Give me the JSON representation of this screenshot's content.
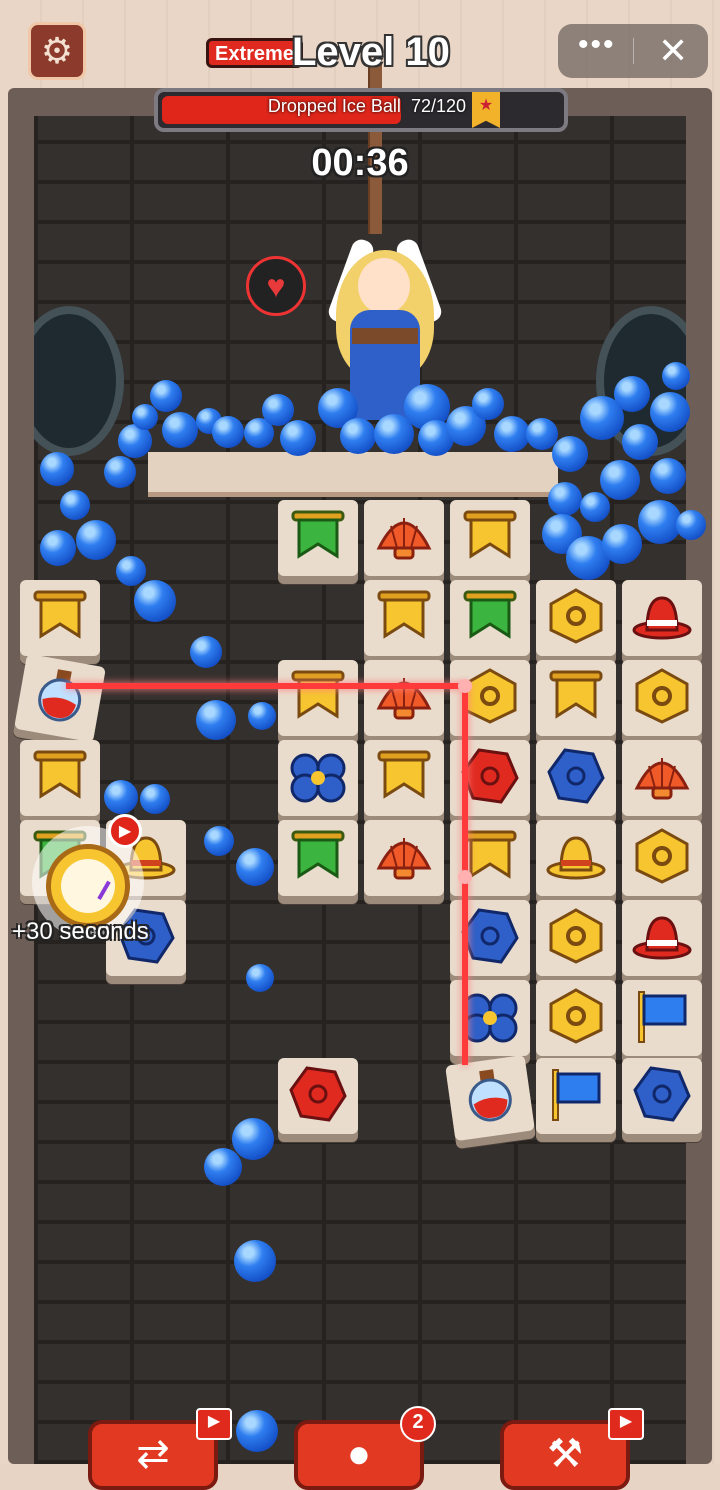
{
  "header": {
    "difficulty": "Extreme",
    "level": "Level 10",
    "menu_dots": "•••",
    "close_symbol": "✕",
    "settings_symbol": "⚙"
  },
  "progress": {
    "label": "Dropped Ice Ball",
    "value": 72,
    "max": 120,
    "text": "72/120",
    "fill_color": "#e0261a"
  },
  "timer": "00:36",
  "heart_symbol": "♥",
  "bonus": {
    "text": "+30 seconds",
    "video_symbol": "▶"
  },
  "tools": [
    {
      "name": "shuffle",
      "symbol": "⇄",
      "ad": true,
      "ad_symbol": "▶"
    },
    {
      "name": "hint",
      "symbol": "●",
      "count": "2"
    },
    {
      "name": "hammer",
      "symbol": "⚒",
      "ad": true,
      "ad_symbol": "▶"
    }
  ],
  "colors": {
    "tile_face": "#e9dccd",
    "laser": "#ff3a3a",
    "ice_ball": "#2f7ef0",
    "brick_wall": "#34302e"
  },
  "tiles": [
    {
      "icon": "banner-green"
    },
    {
      "icon": "shell-red"
    },
    {
      "icon": "banner-yellow"
    },
    {
      "icon": "banner-yellow"
    },
    {
      "icon": "banner-yellow"
    },
    {
      "icon": "banner-green"
    },
    {
      "icon": "coin-hex-gold"
    },
    {
      "icon": "hat-red"
    },
    {
      "icon": "potion-red"
    },
    {
      "icon": "banner-yellow"
    },
    {
      "icon": "shell-red"
    },
    {
      "icon": "coin-hex-gold"
    },
    {
      "icon": "banner-yellow"
    },
    {
      "icon": "coin-hex-gold"
    },
    {
      "icon": "banner-yellow"
    },
    {
      "icon": "flower-blue"
    },
    {
      "icon": "banner-yellow"
    },
    {
      "icon": "gem-red"
    },
    {
      "icon": "gem-blue"
    },
    {
      "icon": "shell-red"
    },
    {
      "icon": "banner-green"
    },
    {
      "icon": "hat-yellow"
    },
    {
      "icon": "banner-green"
    },
    {
      "icon": "shell-red"
    },
    {
      "icon": "banner-yellow"
    },
    {
      "icon": "hat-yellow"
    },
    {
      "icon": "coin-hex-gold"
    },
    {
      "icon": "gem-blue"
    },
    {
      "icon": "gem-blue"
    },
    {
      "icon": "coin-hex-gold"
    },
    {
      "icon": "hat-red"
    },
    {
      "icon": "flower-blue"
    },
    {
      "icon": "coin-hex-gold"
    },
    {
      "icon": "flag-blue"
    },
    {
      "icon": "gem-red"
    },
    {
      "icon": "potion-red"
    },
    {
      "icon": "flag-blue"
    },
    {
      "icon": "gem-blue"
    }
  ]
}
